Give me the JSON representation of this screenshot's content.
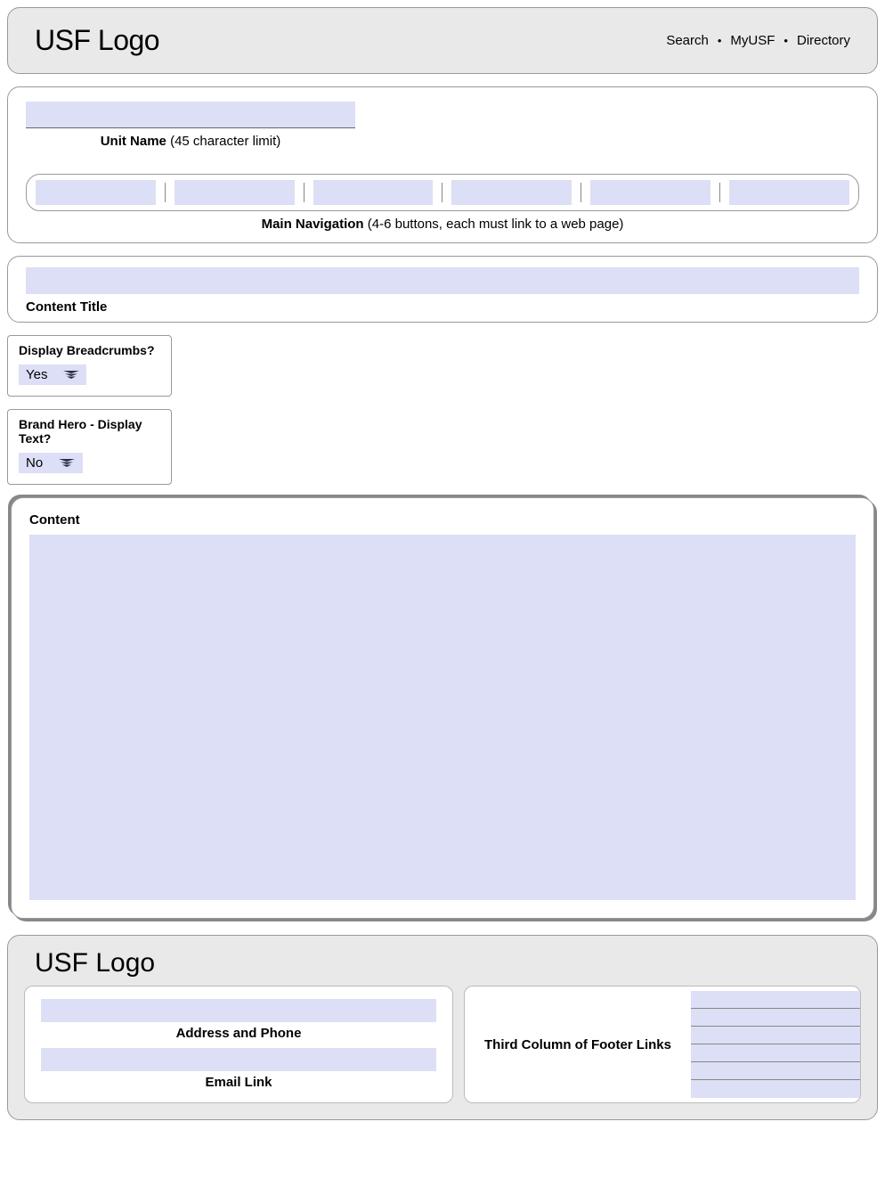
{
  "header": {
    "logo": "USF Logo",
    "links": [
      "Search",
      "MyUSF",
      "Directory"
    ]
  },
  "unit_name": {
    "label_bold": "Unit Name",
    "label_rest": " (45 character limit)"
  },
  "main_nav": {
    "label_bold": "Main Navigation",
    "label_rest": " (4-6 buttons, each must link to a web page)"
  },
  "content_title": {
    "label": "Content Title"
  },
  "breadcrumbs": {
    "label": "Display Breadcrumbs?",
    "value": "Yes"
  },
  "brand_hero": {
    "label": "Brand Hero - Display Text?",
    "value": "No"
  },
  "content": {
    "label": "Content"
  },
  "footer": {
    "logo": "USF Logo",
    "col1": {
      "label1": "Address and Phone",
      "label2": "Email Link"
    },
    "col2": {
      "label": "Third Column of Footer Links"
    }
  }
}
